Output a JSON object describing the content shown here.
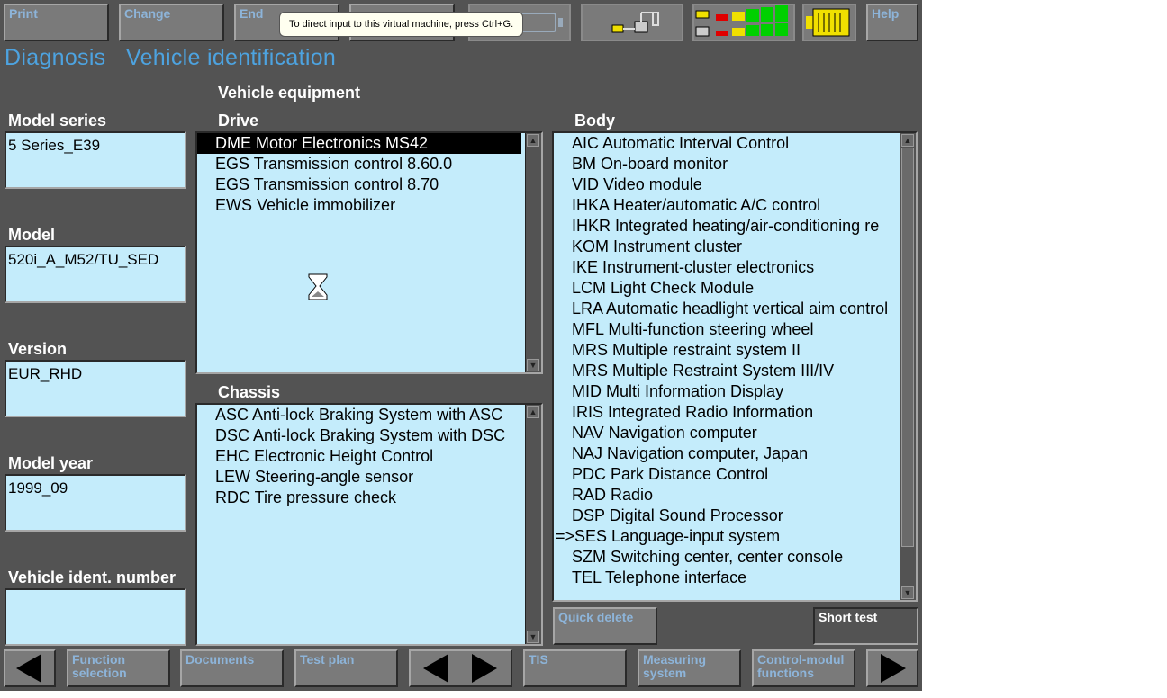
{
  "toolbar": {
    "print": "Print",
    "change": "Change",
    "end": "End",
    "help": "Help"
  },
  "tooltip": "To direct input to this virtual machine, press Ctrl+G.",
  "header": {
    "section": "Diagnosis",
    "page": "Vehicle identification"
  },
  "equipment_heading": "Vehicle equipment",
  "fields": {
    "model_series": {
      "label": "Model series",
      "value": "5 Series_E39"
    },
    "model": {
      "label": "Model",
      "value": "520i_A_M52/TU_SED"
    },
    "version": {
      "label": "Version",
      "value": "EUR_RHD"
    },
    "model_year": {
      "label": "Model year",
      "value": "1999_09"
    },
    "vin": {
      "label": "Vehicle ident. number",
      "value": ""
    }
  },
  "drive": {
    "label": "Drive",
    "items": [
      "DME Motor Electronics MS42",
      "EGS Transmission control 8.60.0",
      "EGS Transmission control 8.70",
      "EWS Vehicle immobilizer"
    ]
  },
  "chassis": {
    "label": "Chassis",
    "items": [
      "ASC Anti-lock Braking System with ASC",
      "DSC Anti-lock Braking System with DSC",
      "EHC Electronic Height Control",
      "LEW Steering-angle sensor",
      "RDC Tire pressure check"
    ]
  },
  "body": {
    "label": "Body",
    "items": [
      "AIC Automatic Interval Control",
      "BM On-board monitor",
      "VID Video module",
      "IHKA Heater/automatic A/C control",
      "IHKR Integrated heating/air-conditioning re",
      "KOM Instrument cluster",
      "IKE Instrument-cluster electronics",
      "LCM Light Check Module",
      "LRA Automatic headlight vertical aim control",
      "MFL Multi-function steering wheel",
      "MRS Multiple restraint system II",
      "MRS Multiple Restraint System III/IV",
      "MID Multi Information Display",
      "IRIS Integrated Radio Information",
      "NAV Navigation computer",
      "NAJ Navigation computer, Japan",
      "PDC Park Distance Control",
      "RAD Radio",
      "DSP Digital Sound Processor",
      "=>SES Language-input system",
      "SZM Switching center, center console",
      "TEL Telephone interface"
    ]
  },
  "actions": {
    "quick_delete": "Quick delete",
    "short_test": "Short test"
  },
  "bottom": {
    "function_selection": "Function selection",
    "documents": "Documents",
    "test_plan": "Test plan",
    "tis": "TIS",
    "measuring_system": "Measuring system",
    "control_module_functions": "Control-modul functions"
  },
  "colors": {
    "background": "#535353",
    "list_bg": "#c4ecfb",
    "title": "#4da3e0",
    "green": "#00d000",
    "yellow": "#f0e000",
    "red": "#e00000"
  }
}
